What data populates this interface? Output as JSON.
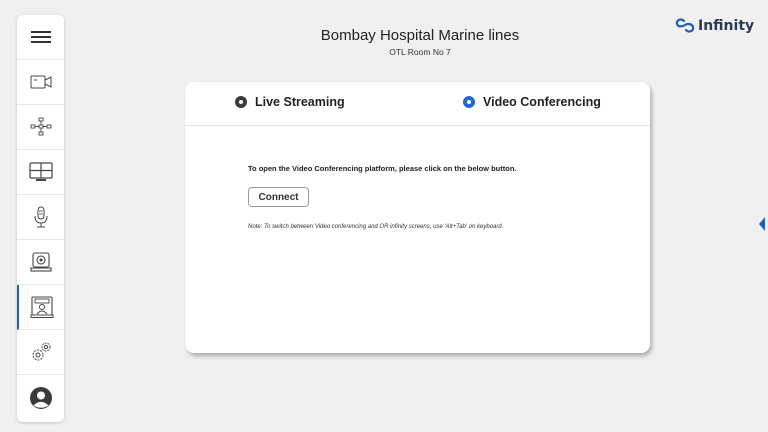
{
  "header": {
    "title": "Bombay Hospital Marine lines",
    "subtitle": "OTL Room No 7"
  },
  "brand": {
    "name": "Infinity",
    "icon": "infinity-logo-icon"
  },
  "sidebar": {
    "items": [
      {
        "icon": "menu-icon"
      },
      {
        "icon": "video-camera-icon"
      },
      {
        "icon": "network-icon"
      },
      {
        "icon": "display-layout-icon"
      },
      {
        "icon": "microphone-icon"
      },
      {
        "icon": "webcam-icon"
      },
      {
        "icon": "video-conference-icon",
        "active": true
      },
      {
        "icon": "settings-icon"
      },
      {
        "icon": "user-profile-icon"
      }
    ]
  },
  "tabs": {
    "live_label": "Live Streaming",
    "video_label": "Video Conferencing",
    "selected": "Video Conferencing"
  },
  "content": {
    "instruction": "To open the Video Conferencing platform, please click on the below button.",
    "connect_label": "Connect",
    "note": "Note: To switch between Video conferencing and OR infinity screens, use 'Alt+Tab' on keyboard."
  },
  "colors": {
    "accent": "#1f5fb5",
    "radio_selected": "#1f6ad1",
    "background": "#f0f0f0",
    "brand_text": "#2a3a55"
  }
}
